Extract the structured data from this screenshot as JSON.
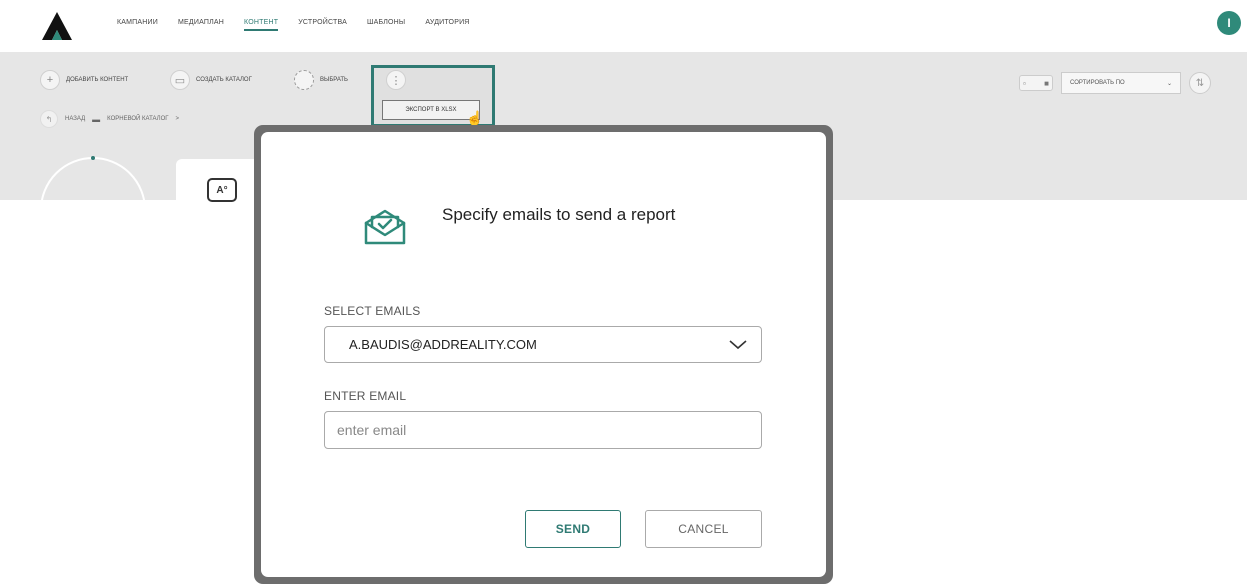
{
  "nav": {
    "items": [
      "КАМПАНИИ",
      "МЕДИАПЛАН",
      "КОНТЕНТ",
      "УСТРОЙСТВА",
      "ШАБЛОНЫ",
      "АУДИТОРИЯ"
    ],
    "active": "КОНТЕНТ",
    "user_initial": "I"
  },
  "toolbar": {
    "add_content": "ДОБАВИТЬ КОНТЕНТ",
    "create_catalog": "СОЗДАТЬ КАТАЛОГ",
    "select": "ВЫБРАТЬ",
    "more": "⋮",
    "export_xlsx": "ЭКСПОРТ В XLSX",
    "back": "НАЗАД",
    "root_catalog": "КОРНЕВОЙ КАТАЛОГ",
    "crumb_sep": ">",
    "sort_by": "СОРТИРОВАТЬ ПО"
  },
  "modal": {
    "title": "Specify emails to send a report",
    "select_label": "SELECT EMAILS",
    "selected_email": "A.BAUDIS@ADDREALITY.COM",
    "enter_label": "ENTER EMAIL",
    "email_placeholder": "enter email",
    "send": "SEND",
    "cancel": "CANCEL"
  },
  "colors": {
    "accent": "#2f7a73",
    "toolbar_bg": "#e6e6e6",
    "modal_frame": "#6d6d6d"
  },
  "icons": {
    "logo": "brand-logo",
    "mail": "envelope-check-icon",
    "chevron": "chevron-down-icon"
  }
}
